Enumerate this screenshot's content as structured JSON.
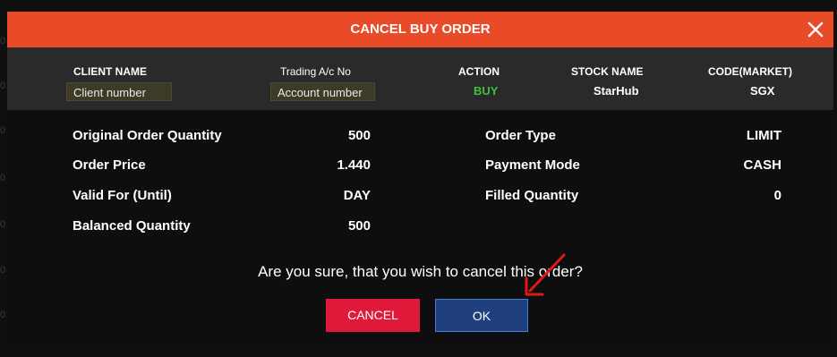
{
  "dialog": {
    "title": "CANCEL BUY ORDER",
    "close_symbol": "✕"
  },
  "info": {
    "client_name": {
      "label": "CLIENT NAME",
      "value": "Client number"
    },
    "trading_ac": {
      "label": "Trading A/c No",
      "value": "Account number"
    },
    "action": {
      "label": "ACTION",
      "value": "BUY"
    },
    "stock_name": {
      "label": "STOCK NAME",
      "value": "StarHub"
    },
    "code_market": {
      "label": "CODE(MARKET)",
      "value": "SGX"
    }
  },
  "details": {
    "original_qty": {
      "label": "Original Order Quantity",
      "value": "500"
    },
    "order_price": {
      "label": "Order Price",
      "value": "1.440"
    },
    "valid_for": {
      "label": "Valid For (Until)",
      "value": "DAY"
    },
    "balanced_qty": {
      "label": "Balanced Quantity",
      "value": "500"
    },
    "order_type": {
      "label": "Order Type",
      "value": "LIMIT"
    },
    "payment_mode": {
      "label": "Payment Mode",
      "value": "CASH"
    },
    "filled_qty": {
      "label": "Filled Quantity",
      "value": "0"
    }
  },
  "confirm": {
    "message": "Are you sure, that you wish to cancel this order?",
    "cancel_label": "CANCEL",
    "ok_label": "OK"
  },
  "background": {
    "zero": "0"
  },
  "colors": {
    "header": "#e94a27",
    "buy": "#3fbf3f",
    "cancel_button": "#e0193a",
    "ok_button": "#1f3f7f",
    "annotation_arrow": "#e01818"
  }
}
